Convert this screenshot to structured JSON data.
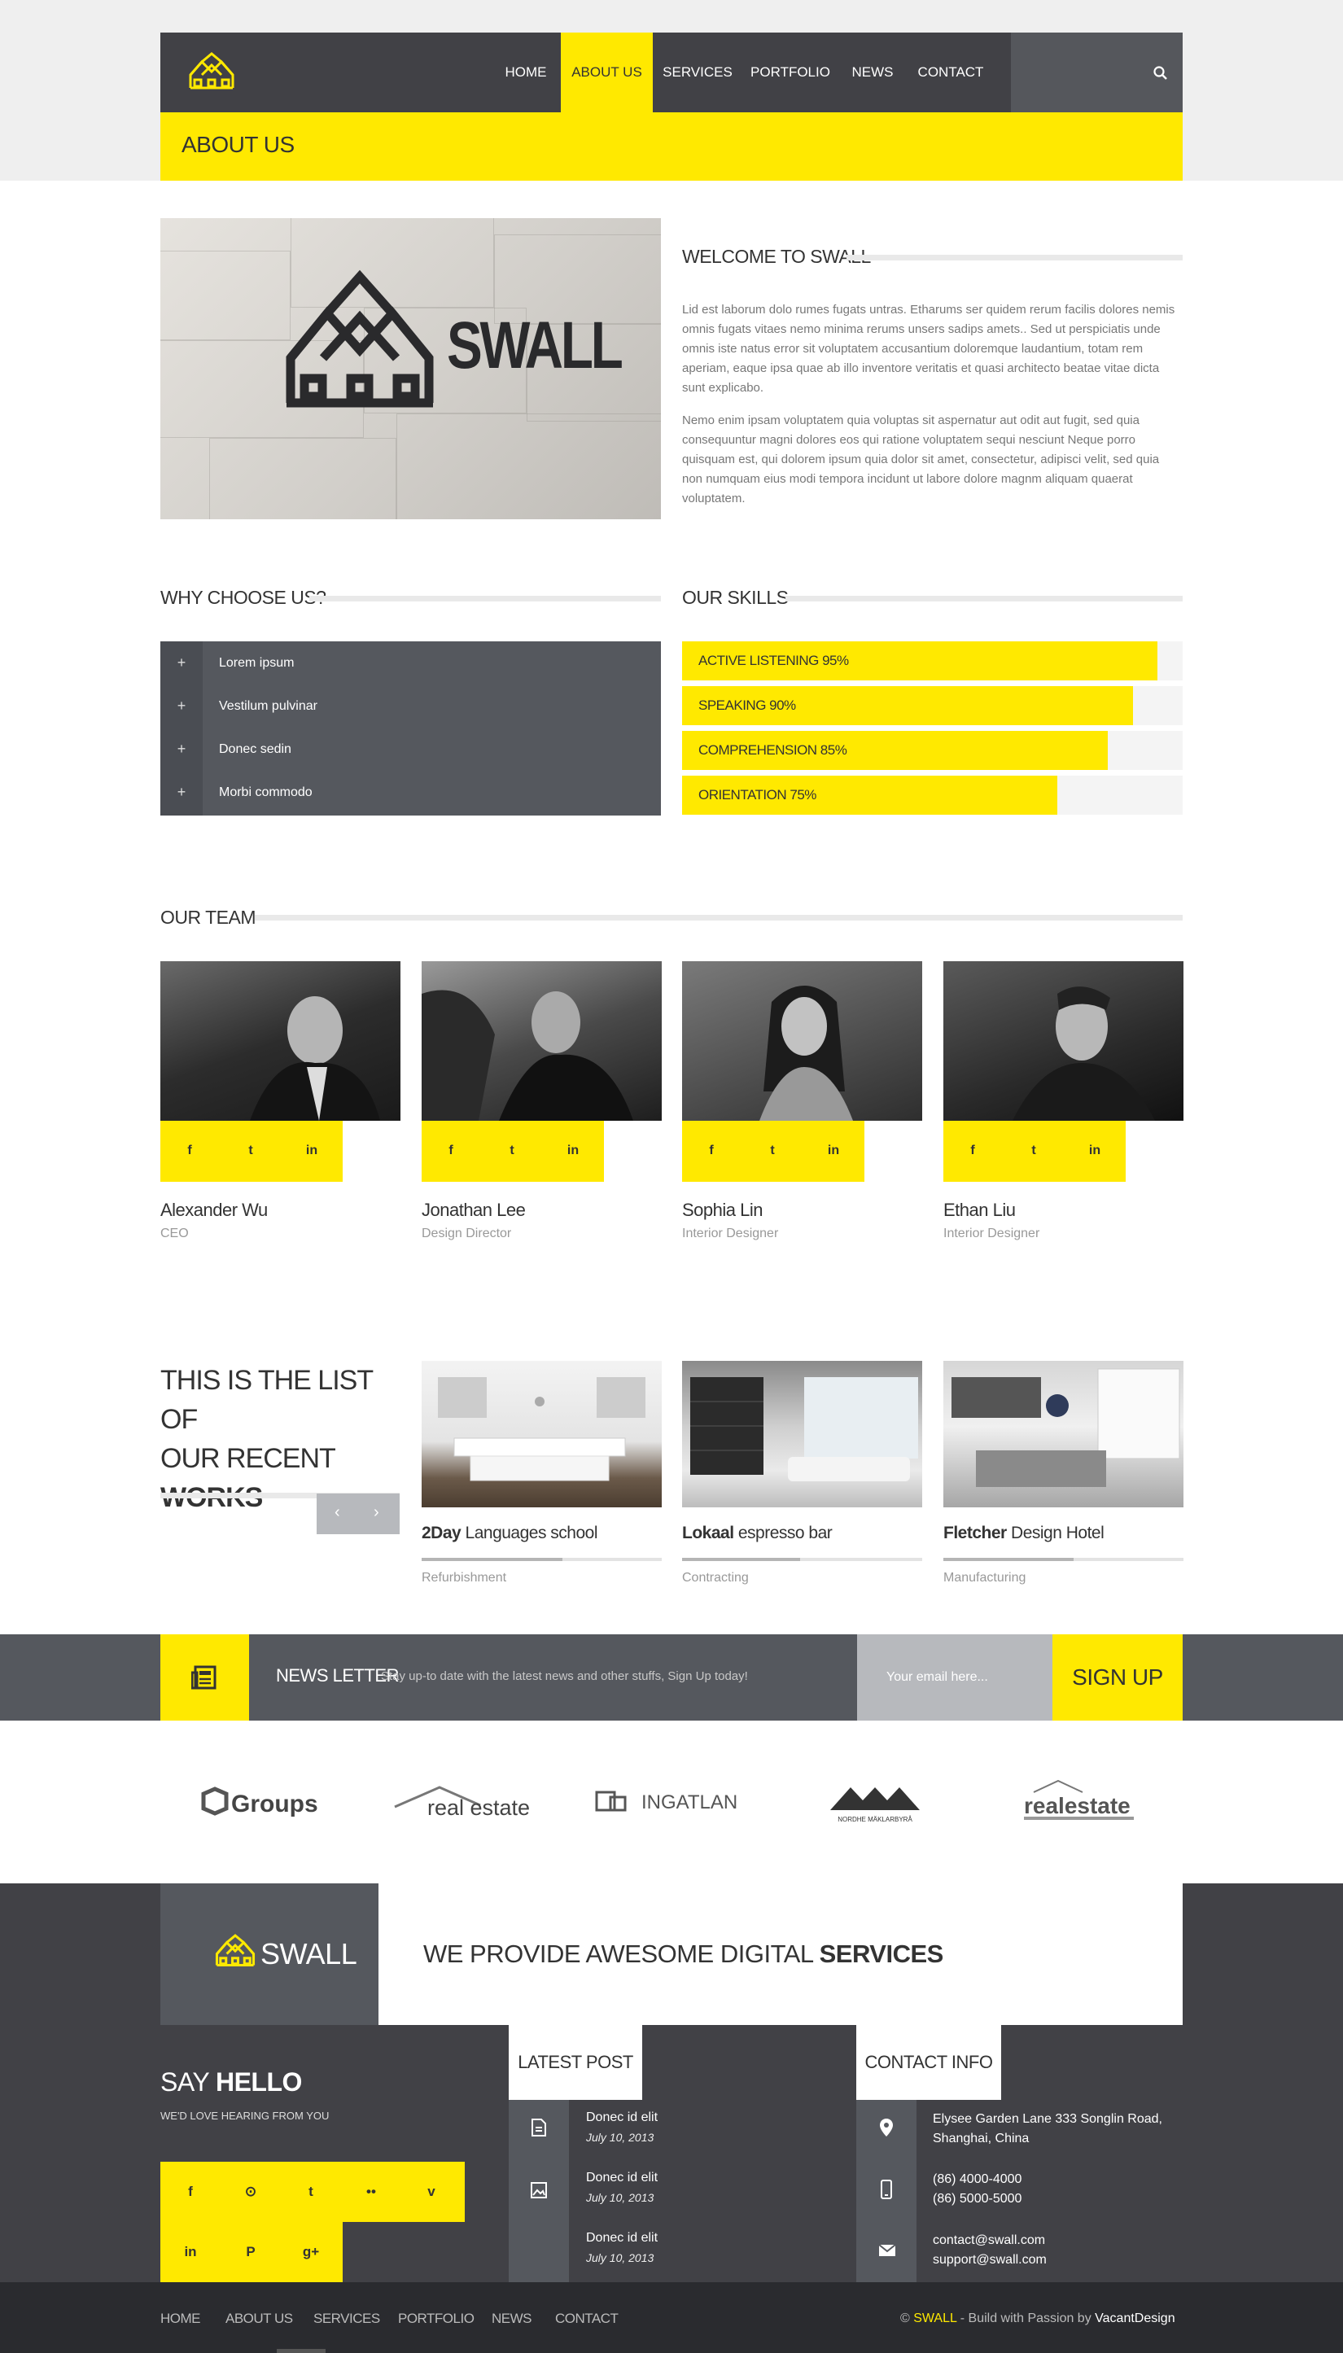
{
  "header": {
    "nav": [
      "HOME",
      "ABOUT US",
      "SERVICES",
      "PORTFOLIO",
      "NEWS",
      "CONTACT"
    ],
    "active_nav": "ABOUT US",
    "page_title": "ABOUT US"
  },
  "welcome": {
    "heading": "WELCOME TO SWALL",
    "logo_text": "SWALL",
    "paragraph1": "Lid est laborum dolo rumes fugats untras. Etharums ser quidem rerum facilis dolores nemis omnis fugats vitaes nemo minima rerums unsers sadips amets.. Sed ut perspiciatis unde omnis iste natus error sit voluptatem accusantium doloremque laudantium, totam rem aperiam, eaque ipsa quae ab illo inventore veritatis et quasi architecto beatae vitae dicta sunt explicabo.",
    "paragraph2": "Nemo enim ipsam voluptatem quia voluptas sit aspernatur aut odit aut fugit, sed quia consequuntur magni dolores eos qui ratione voluptatem sequi nesciunt Neque porro quisquam est, qui dolorem ipsum quia dolor sit amet, consectetur, adipisci velit, sed quia non numquam eius modi tempora incidunt ut labore dolore magnm aliquam quaerat voluptatem."
  },
  "why_choose": {
    "heading": "WHY CHOOSE US?",
    "items": [
      "Lorem ipsum",
      "Vestilum pulvinar",
      "Donec sedin",
      "Morbi commodo"
    ]
  },
  "skills": {
    "heading": "OUR SKILLS",
    "items": [
      {
        "label": "ACTIVE LISTENING 95%",
        "value": 95
      },
      {
        "label": "SPEAKING 90%",
        "value": 90
      },
      {
        "label": "COMPREHENSION 85%",
        "value": 85
      },
      {
        "label": "ORIENTATION 75%",
        "value": 75
      }
    ]
  },
  "team": {
    "heading": "OUR TEAM",
    "members": [
      {
        "name": "Alexander Wu",
        "role": "CEO"
      },
      {
        "name": "Jonathan Lee",
        "role": "Design Director"
      },
      {
        "name": "Sophia Lin",
        "role": "Interior Designer"
      },
      {
        "name": "Ethan Liu",
        "role": "Interior Designer"
      }
    ],
    "social_icons": [
      "facebook-icon",
      "twitter-icon",
      "linkedin-icon"
    ]
  },
  "works": {
    "title_line1": "THIS IS THE LIST OF",
    "title_line2": "OUR RECENT",
    "title_line3": "WORKS",
    "items": [
      {
        "title_bold": "2Day",
        "title_rest": " Languages school",
        "category": "Refurbishment"
      },
      {
        "title_bold": "Lokaal",
        "title_rest": " espresso bar",
        "category": "Contracting"
      },
      {
        "title_bold": "Fletcher",
        "title_rest": " Design Hotel",
        "category": "Manufacturing"
      }
    ]
  },
  "newsletter": {
    "title": "NEWS LETTER",
    "subtitle": "Stay up-to date with the latest news and other stuffs, Sign Up today!",
    "placeholder": "Your email here...",
    "button": "SIGN UP"
  },
  "partners": [
    "Groups",
    "real estate",
    "INGATLAN",
    "NORDHE MÄKLARBYRÅ",
    "realestate"
  ],
  "footer": {
    "logo_text": "SWALL",
    "slogan_light": "WE PROVIDE AWESOME DIGITAL ",
    "slogan_bold": "SERVICES",
    "say_hello_light": "SAY ",
    "say_hello_bold": "HELLO",
    "say_hello_sub": "WE'D LOVE HEARING FROM YOU",
    "latest_post_title": "LATEST POST",
    "posts": [
      {
        "title": "Donec id elit",
        "date": "July 10, 2013"
      },
      {
        "title": "Donec id elit",
        "date": "July 10, 2013"
      },
      {
        "title": "Donec id elit",
        "date": "July 10, 2013"
      }
    ],
    "contact_title": "CONTACT INFO",
    "address_line1": "Elysee Garden Lane 333 Songlin Road,",
    "address_line2": "Shanghai, China",
    "phone1": "(86) 4000-4000",
    "phone2": "(86) 5000-5000",
    "email1": "contact@swall.com",
    "email2": "support@swall.com"
  },
  "bottom": {
    "nav": [
      "HOME",
      "ABOUT US",
      "SERVICES",
      "PORTFOLIO",
      "NEWS",
      "CONTACT"
    ],
    "copy_prefix": "© ",
    "copy_brand": "SWALL",
    "copy_middle": " - Build with Passion by ",
    "copy_author": "VacantDesign"
  },
  "colors": {
    "accent": "#ffe900",
    "dark": "#414146",
    "mid": "#55585e"
  }
}
